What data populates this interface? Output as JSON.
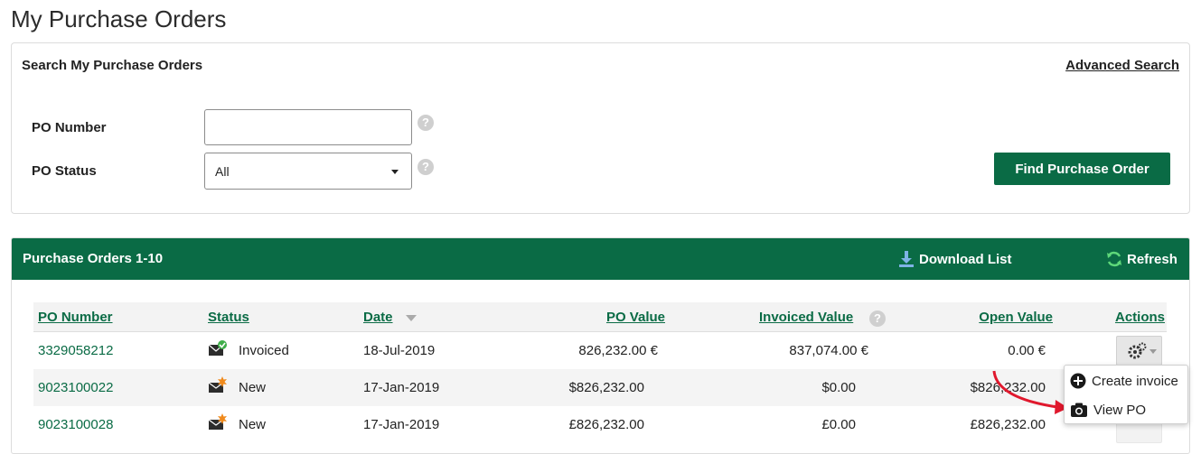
{
  "page": {
    "title": "My Purchase Orders"
  },
  "search": {
    "title": "Search My Purchase Orders",
    "advanced_link": "Advanced Search",
    "po_number_label": "PO Number",
    "po_number_value": "",
    "po_status_label": "PO Status",
    "po_status_value": "All",
    "find_button": "Find Purchase Order"
  },
  "orders": {
    "title": "Purchase Orders 1-10",
    "download": "Download List",
    "refresh": "Refresh",
    "columns": [
      "PO Number",
      "Status",
      "Date",
      "PO Value",
      "Invoiced Value",
      "Open Value",
      "Actions"
    ],
    "rows": [
      {
        "po_number": "3329058212",
        "status": "Invoiced",
        "status_icon": "invoiced-mail-icon",
        "date": "18-Jul-2019",
        "po_value": "826,232.00 €",
        "invoiced_value": "837,074.00 €",
        "open_value": "0.00 €"
      },
      {
        "po_number": "9023100022",
        "status": "New",
        "status_icon": "new-mail-icon",
        "date": "17-Jan-2019",
        "po_value": "$826,232.00",
        "invoiced_value": "$0.00",
        "open_value": "$826,232.00"
      },
      {
        "po_number": "9023100028",
        "status": "New",
        "status_icon": "new-mail-icon",
        "date": "17-Jan-2019",
        "po_value": "£826,232.00",
        "invoiced_value": "£0.00",
        "open_value": "£826,232.00"
      }
    ]
  },
  "action_menu": {
    "items": [
      {
        "label": "Create invoice",
        "icon": "plus-circle-icon"
      },
      {
        "label": "View PO",
        "icon": "camera-icon"
      }
    ]
  },
  "colors": {
    "brand_green": "#0a6b45",
    "annotation_red": "#e0182d"
  }
}
